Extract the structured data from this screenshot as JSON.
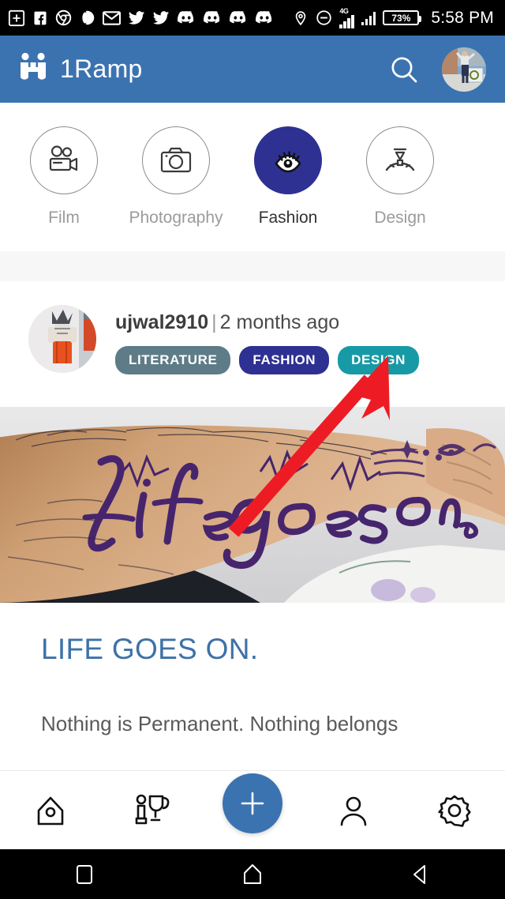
{
  "status_bar": {
    "time": "5:58 PM",
    "battery_percent": "73%",
    "network_type": "4G",
    "icons": [
      "add-box-icon",
      "facebook-icon",
      "chrome-icon",
      "opera-icon",
      "gmail-icon",
      "twitter-icon",
      "twitter-icon-2",
      "discord-icon",
      "discord-icon-2",
      "discord-icon-3",
      "discord-icon-4"
    ],
    "right_icons": [
      "location-pin-icon",
      "do-not-disturb-icon",
      "signal-4g-icon",
      "signal-icon",
      "battery-icon"
    ]
  },
  "app_bar": {
    "title": "1Ramp",
    "logo_name": "1ramp-logo-icon",
    "search_label": "Search",
    "avatar_label": "Profile picture",
    "background_color": "#3B73B0"
  },
  "categories": {
    "items": [
      {
        "label": "",
        "icon": "partial-category-icon",
        "active": false,
        "partial": true
      },
      {
        "label": "Film",
        "icon": "video-camera-icon",
        "active": false,
        "partial": false
      },
      {
        "label": "Photography",
        "icon": "camera-icon",
        "active": false,
        "partial": false
      },
      {
        "label": "Fashion",
        "icon": "eye-icon",
        "active": true,
        "partial": false
      },
      {
        "label": "Design",
        "icon": "compass-divider-icon",
        "active": false,
        "partial": false
      }
    ],
    "active_color": "#2E3192",
    "inactive_label_color": "#9b9b9b"
  },
  "post": {
    "author": "ujwal2910",
    "separator": "|",
    "timestamp": "2 months ago",
    "tags": [
      {
        "label": "LITERATURE",
        "color": "#5E7C87"
      },
      {
        "label": "FASHION",
        "color": "#2E3192"
      },
      {
        "label": "DESIGN",
        "color": "#179AA6"
      }
    ],
    "image_alt": "Forearm with Life goes on written in purple ink",
    "title": "LIFE GOES ON.",
    "title_color": "#3D72A8",
    "body": "Nothing is Permanent. Nothing belongs"
  },
  "bottom_nav": {
    "items": [
      {
        "label": "Home",
        "icon": "home-icon"
      },
      {
        "label": "Leaderboard",
        "icon": "trophy-person-icon"
      },
      {
        "label": "Create",
        "icon": "plus-icon"
      },
      {
        "label": "Profile",
        "icon": "person-icon"
      },
      {
        "label": "Settings",
        "icon": "gear-icon"
      }
    ],
    "fab_color": "#3B73B0"
  },
  "android_nav": {
    "items": [
      {
        "label": "Recents",
        "icon": "square-icon"
      },
      {
        "label": "Home",
        "icon": "home-pentagon-icon"
      },
      {
        "label": "Back",
        "icon": "back-triangle-icon"
      }
    ]
  },
  "annotation": {
    "type": "arrow",
    "color": "#ED1C24",
    "points_to": "DESIGN"
  }
}
